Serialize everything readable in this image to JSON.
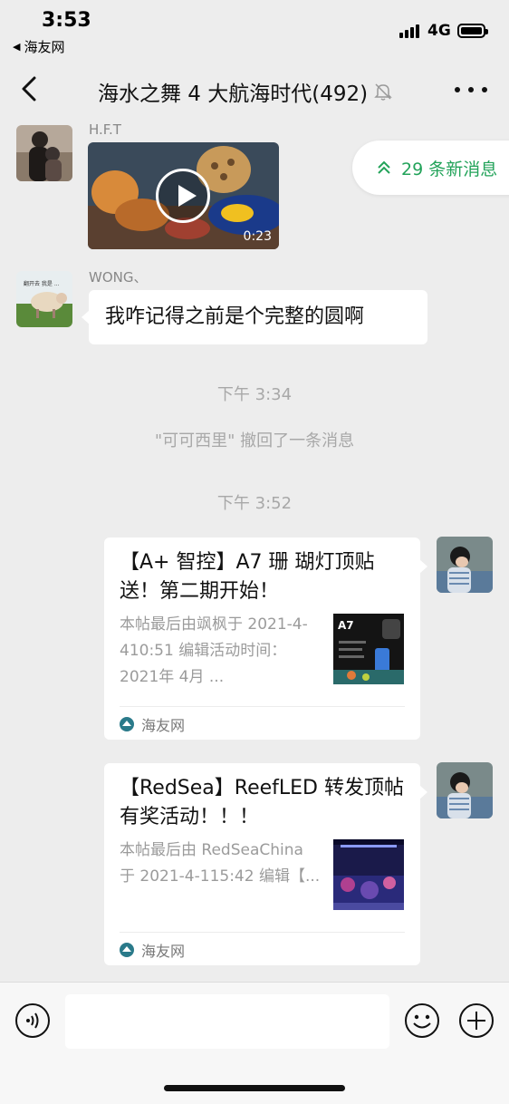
{
  "status_bar": {
    "time": "3:53",
    "back_app": "海友网",
    "network": "4G",
    "icons": [
      "signal-icon",
      "battery-icon"
    ]
  },
  "nav": {
    "title": "海水之舞 4 大航海时代(492)",
    "icons": [
      "back-icon",
      "mute-icon",
      "more-icon"
    ]
  },
  "new_messages": {
    "label": "29 条新消息",
    "icon": "double-chevron-up-icon"
  },
  "messages": [
    {
      "sender": "H.F.T",
      "type": "video",
      "duration": "0:23"
    },
    {
      "sender": "WONG、",
      "type": "text",
      "text": "我咋记得之前是个完整的圆啊"
    }
  ],
  "system": {
    "time1": "下午 3:34",
    "recall": "\"可可西里\" 撤回了一条消息",
    "time2": "下午 3:52"
  },
  "cards": [
    {
      "title": "【A+ 智控】A7 珊 瑚灯顶贴送！第二期开始！",
      "desc": "本帖最后由飒枫于 2021-4-410:51 编辑活动时间：2021年 4月 ...",
      "thumb_text": "A7",
      "source": "海友网"
    },
    {
      "title": "【RedSea】ReefLED 转发顶帖有奖活动！！！",
      "desc": "本帖最后由 RedSeaChina 于 2021-4-115:42 编辑【...",
      "source": "海友网"
    }
  ],
  "input_bar": {
    "placeholder": "",
    "icons": [
      "voice-icon",
      "emoji-icon",
      "plus-icon"
    ]
  },
  "colors": {
    "accent_green": "#23a35a",
    "background": "#ededed"
  }
}
